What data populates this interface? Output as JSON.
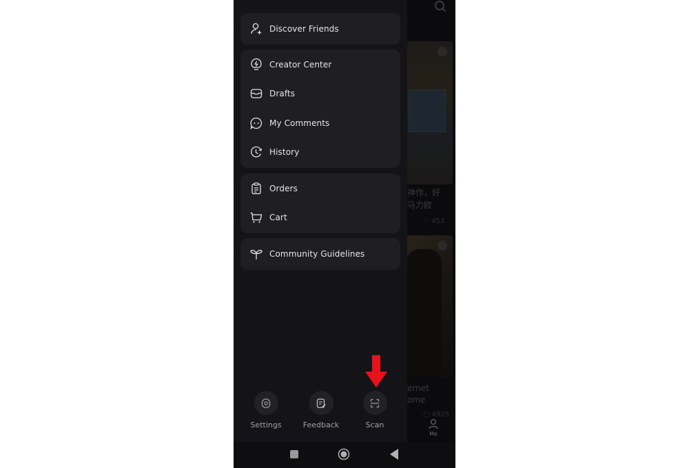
{
  "drawer": {
    "groups": [
      {
        "items": [
          {
            "label": "Discover Friends",
            "icon": "add-user-icon"
          }
        ]
      },
      {
        "items": [
          {
            "label": "Creator Center",
            "icon": "lightbulb-bolt-icon"
          },
          {
            "label": "Drafts",
            "icon": "inbox-tray-icon"
          },
          {
            "label": "My Comments",
            "icon": "chat-bubble-icon"
          },
          {
            "label": "History",
            "icon": "clock-history-icon"
          }
        ]
      },
      {
        "items": [
          {
            "label": "Orders",
            "icon": "clipboard-icon"
          },
          {
            "label": "Cart",
            "icon": "cart-icon"
          }
        ]
      },
      {
        "items": [
          {
            "label": "Community Guidelines",
            "icon": "sprout-icon"
          }
        ]
      }
    ],
    "bottom_actions": [
      {
        "label": "Settings",
        "icon": "gear-icon"
      },
      {
        "label": "Feedback",
        "icon": "feedback-note-icon"
      },
      {
        "label": "Scan",
        "icon": "scan-icon"
      }
    ],
    "annotation": {
      "icon": "red-arrow-down-icon",
      "color": "#e8121a",
      "points_to": "Scan"
    }
  },
  "background_app": {
    "card1_caption_line1": "神作，好",
    "card1_caption_line2": "马力欧",
    "card1_likes": "453",
    "card2_caption_line1": "ernet",
    "card2_caption_line2": "ome",
    "card2_comments": "4925",
    "nav_me_label": "Me"
  },
  "colors": {
    "drawer_bg": "#141418",
    "group_bg": "#1e1e23",
    "item_text": "#e6e6ea",
    "bottom_label": "#a0a0a6",
    "arrow": "#e8121a"
  }
}
